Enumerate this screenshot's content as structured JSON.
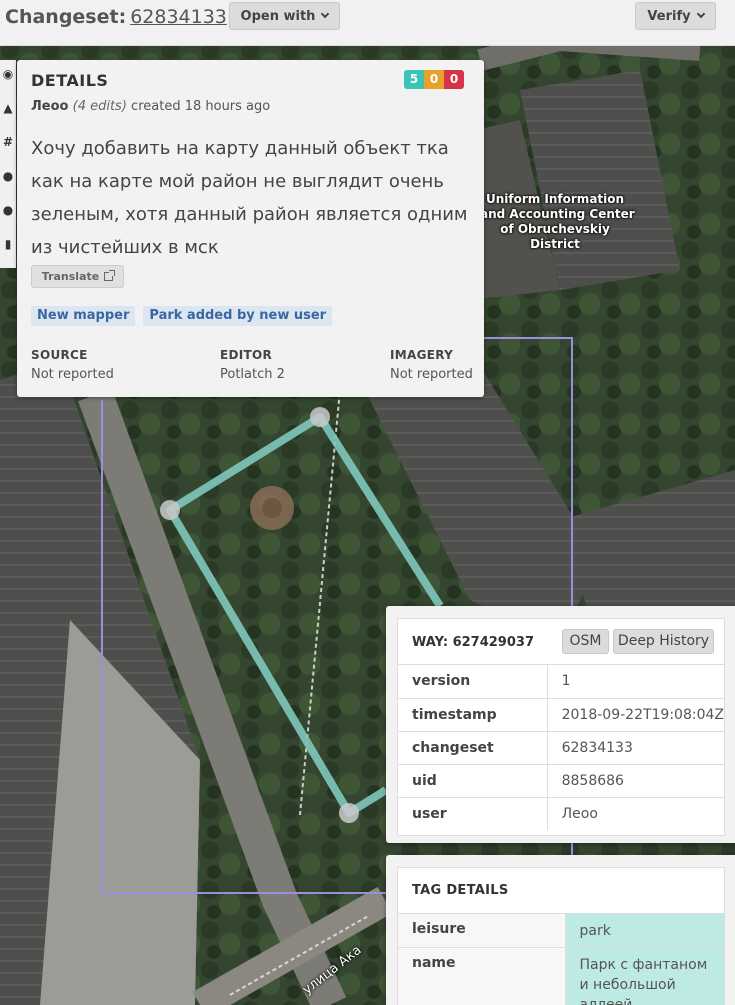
{
  "header": {
    "title_label": "Changeset:",
    "changeset_id": "62834133",
    "open_with_label": "Open with",
    "verify_label": "Verify"
  },
  "side_tools": {
    "icons": [
      "eye-icon",
      "warning-icon",
      "hash-icon",
      "circle-icon",
      "user-icon",
      "bars-icon"
    ],
    "glyphs": [
      "◉",
      "▲",
      "#",
      "●",
      "●",
      "▮"
    ]
  },
  "details": {
    "heading": "DETAILS",
    "counts": {
      "create": "5",
      "modify": "0",
      "delete": "0"
    },
    "user": "Леоо",
    "edits": "(4 edits)",
    "created": "created 18 hours ago",
    "comment": "Хочу добавить на карту данный объект тка как на карте мой район не выглядит очень зеленым, хотя данный район является одним из чистейших в мск",
    "translate_label": "Translate",
    "flags": [
      "New mapper",
      "Park added by new user"
    ],
    "source_label": "SOURCE",
    "source_value": "Not reported",
    "editor_label": "EDITOR",
    "editor_value": "Potlatch 2",
    "imagery_label": "IMAGERY",
    "imagery_value": "Not reported"
  },
  "map": {
    "poi_label_lines": [
      "Uniform Information",
      "and Accounting Center",
      "of Obruchevskiy",
      "District"
    ],
    "street_label": "улица Ака"
  },
  "way": {
    "title": "WAY: 627429037",
    "osm_label": "OSM",
    "deep_history_label": "Deep History",
    "rows": [
      {
        "key": "version",
        "value": "1"
      },
      {
        "key": "timestamp",
        "value": "2018-09-22T19:08:04Z"
      },
      {
        "key": "changeset",
        "value": "62834133"
      },
      {
        "key": "uid",
        "value": "8858686"
      },
      {
        "key": "user",
        "value": "Леоо"
      }
    ]
  },
  "tags": {
    "heading": "TAG DETAILS",
    "rows": [
      {
        "key": "leisure",
        "value": "park"
      },
      {
        "key": "name",
        "value": "Парк с фантаном и небольшой аллеей"
      }
    ]
  },
  "colors": {
    "create": "#39c5b4",
    "modify": "#e9a12b",
    "delete": "#d6334a",
    "way_line": "#7fc8bc",
    "bbox": "#9b8fdc",
    "tag_highlight": "#bdebe4"
  }
}
